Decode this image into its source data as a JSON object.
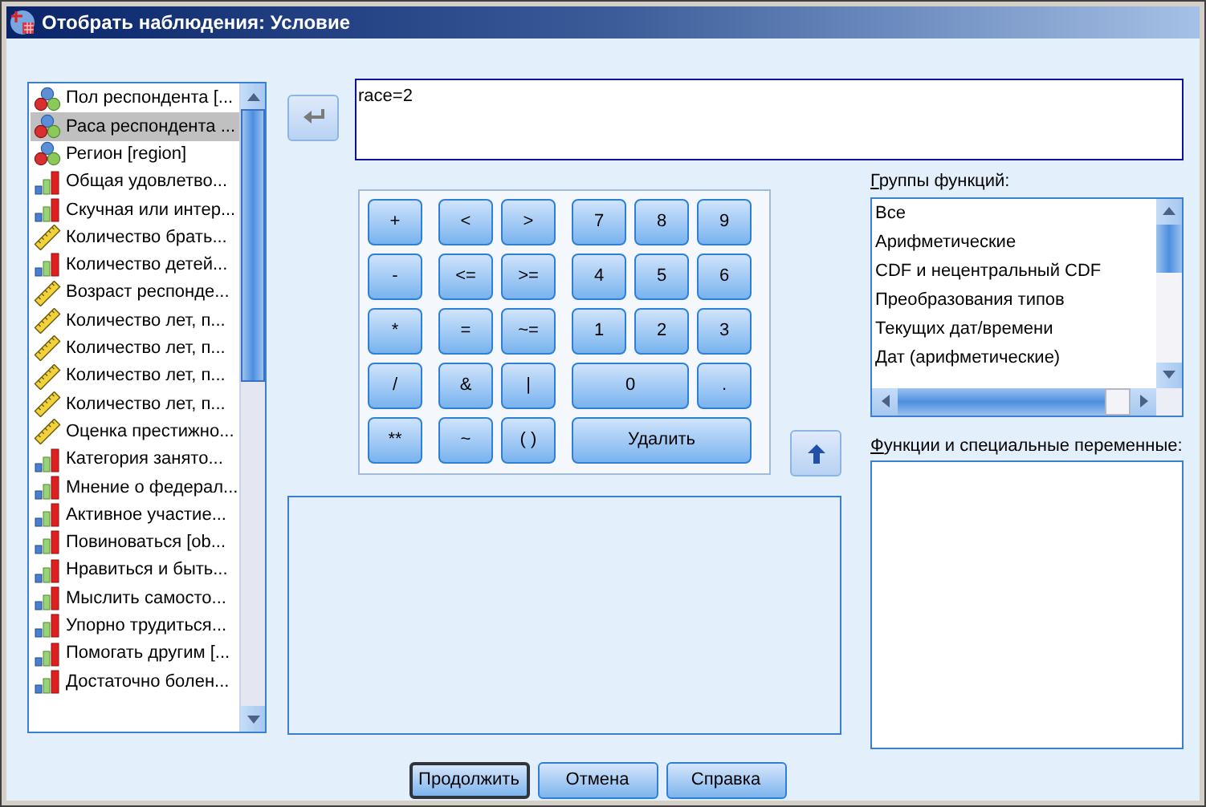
{
  "window": {
    "title": "Отобрать наблюдения: Условие"
  },
  "variables": [
    {
      "name": "Пол респондента [...",
      "kind": "nominal",
      "selected": false
    },
    {
      "name": "Раса респондента ...",
      "kind": "nominal",
      "selected": true
    },
    {
      "name": "Регион [region]",
      "kind": "nominal",
      "selected": false
    },
    {
      "name": "Общая удовлетво...",
      "kind": "ordinal",
      "selected": false
    },
    {
      "name": "Скучная или интер...",
      "kind": "ordinal",
      "selected": false
    },
    {
      "name": "Количество брать...",
      "kind": "scale",
      "selected": false
    },
    {
      "name": "Количество детей...",
      "kind": "ordinal",
      "selected": false
    },
    {
      "name": "Возраст респонде...",
      "kind": "scale",
      "selected": false
    },
    {
      "name": "Количество лет, п...",
      "kind": "scale",
      "selected": false
    },
    {
      "name": "Количество лет, п...",
      "kind": "scale",
      "selected": false
    },
    {
      "name": "Количество лет, п...",
      "kind": "scale",
      "selected": false
    },
    {
      "name": "Количество лет, п...",
      "kind": "scale",
      "selected": false
    },
    {
      "name": "Оценка престижно...",
      "kind": "scale",
      "selected": false
    },
    {
      "name": "Категория занято...",
      "kind": "ordinal",
      "selected": false
    },
    {
      "name": "Мнение о федерал...",
      "kind": "ordinal",
      "selected": false
    },
    {
      "name": "Активное участие...",
      "kind": "ordinal",
      "selected": false
    },
    {
      "name": "Повиноваться [ob...",
      "kind": "ordinal",
      "selected": false
    },
    {
      "name": "Нравиться и быть...",
      "kind": "ordinal",
      "selected": false
    },
    {
      "name": "Мыслить самосто...",
      "kind": "ordinal",
      "selected": false
    },
    {
      "name": "Упорно трудиться...",
      "kind": "ordinal",
      "selected": false
    },
    {
      "name": "Помогать другим [...",
      "kind": "ordinal",
      "selected": false
    },
    {
      "name": "Достаточно болен...",
      "kind": "ordinal",
      "selected": false
    }
  ],
  "expression": {
    "value": "race=2"
  },
  "keypad": [
    [
      {
        "label": "+",
        "kind": "single"
      },
      {
        "label": "-",
        "kind": "single"
      },
      {
        "label": "*",
        "kind": "single"
      },
      {
        "label": "/",
        "kind": "single"
      },
      {
        "label": "**",
        "kind": "single"
      }
    ],
    [
      {
        "label": "<",
        "kind": "single"
      },
      {
        "label": ">",
        "kind": "single"
      },
      {
        "label": "<=",
        "kind": "single"
      },
      {
        "label": ">=",
        "kind": "single"
      },
      {
        "label": "=",
        "kind": "single"
      },
      {
        "label": "~=",
        "kind": "single"
      },
      {
        "label": "&",
        "kind": "single"
      },
      {
        "label": "|",
        "kind": "single"
      },
      {
        "label": "~",
        "kind": "single"
      },
      {
        "label": "( )",
        "kind": "single"
      }
    ],
    [
      {
        "label": "7",
        "kind": "single"
      },
      {
        "label": "8",
        "kind": "single"
      },
      {
        "label": "9",
        "kind": "single"
      },
      {
        "label": "4",
        "kind": "single"
      },
      {
        "label": "5",
        "kind": "single"
      },
      {
        "label": "6",
        "kind": "single"
      },
      {
        "label": "1",
        "kind": "single"
      },
      {
        "label": "2",
        "kind": "single"
      },
      {
        "label": "3",
        "kind": "single"
      },
      {
        "label": "0",
        "kind": "double"
      },
      {
        "label": ".",
        "kind": "single"
      },
      {
        "label": "Удалить",
        "kind": "triple"
      }
    ]
  ],
  "function_groups": {
    "label": "Группы функций:",
    "items": [
      "Все",
      "Арифметические",
      "CDF и нецентральный CDF",
      "Преобразования типов",
      "Текущих дат/времени",
      "Дат (арифметические)"
    ]
  },
  "functions": {
    "label": "Функции и специальные переменные:"
  },
  "buttons": [
    {
      "label": "Продолжить",
      "default": true
    },
    {
      "label": "Отмена",
      "default": false
    },
    {
      "label": "Справка",
      "default": false
    }
  ]
}
